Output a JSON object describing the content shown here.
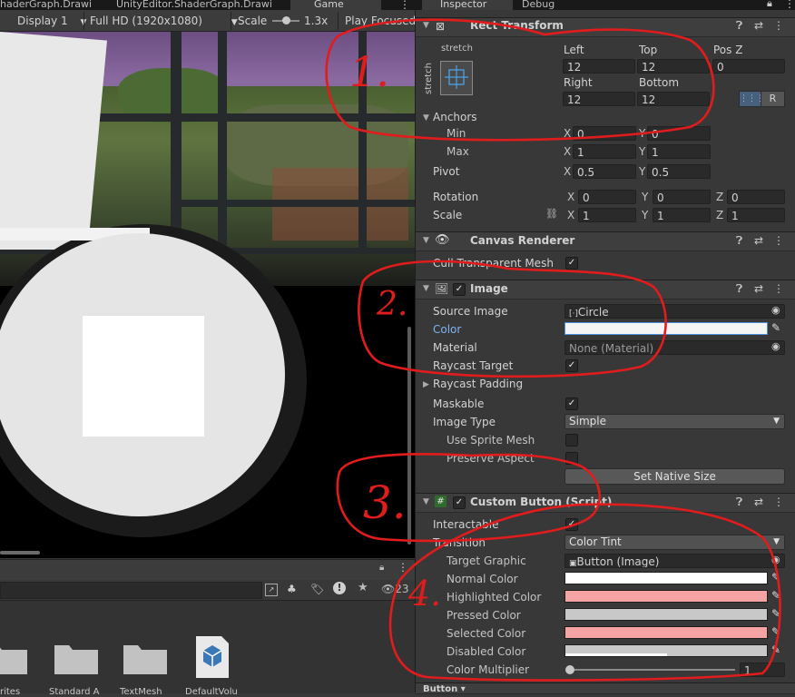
{
  "tabs": {
    "shadergraph1": "haderGraph.Drawi",
    "shadergraph2": "UnityEditor.ShaderGraph.Drawi",
    "game": "Game",
    "inspector": "Inspector",
    "debug": "Debug"
  },
  "game_toolbar": {
    "display": "Display 1",
    "resolution": "Full HD (1920x1080)",
    "scale_label": "Scale",
    "scale_value": "1.3x",
    "play_focused": "Play Focused"
  },
  "project": {
    "count": "23",
    "assets": [
      "rites",
      "Standard A",
      "TextMesh",
      "DefaultVolu"
    ]
  },
  "rect_transform": {
    "title": "Rect Transform",
    "anchor_preset_top": "stretch",
    "anchor_preset_side": "stretch",
    "left_label": "Left",
    "left": "12",
    "top_label": "Top",
    "top": "12",
    "posz_label": "Pos Z",
    "posz": "0",
    "right_label": "Right",
    "right": "12",
    "bottom_label": "Bottom",
    "bottom": "12",
    "raw_btn": "R",
    "anchors_label": "Anchors",
    "min_label": "Min",
    "min_x": "0",
    "min_y": "0",
    "max_label": "Max",
    "max_x": "1",
    "max_y": "1",
    "pivot_label": "Pivot",
    "pivot_x": "0.5",
    "pivot_y": "0.5",
    "rotation_label": "Rotation",
    "rot_x": "0",
    "rot_y": "0",
    "rot_z": "0",
    "scale_label": "Scale",
    "scale_x": "1",
    "scale_y": "1",
    "scale_z": "1"
  },
  "canvas_renderer": {
    "title": "Canvas Renderer",
    "cull_label": "Cull Transparent Mesh"
  },
  "image": {
    "title": "Image",
    "source_label": "Source Image",
    "source_value": "Circle",
    "color_label": "Color",
    "material_label": "Material",
    "material_value": "None (Material)",
    "raycast_target_label": "Raycast Target",
    "raycast_padding_label": "Raycast Padding",
    "maskable_label": "Maskable",
    "image_type_label": "Image Type",
    "image_type_value": "Simple",
    "use_sprite_mesh_label": "Use Sprite Mesh",
    "preserve_aspect_label": "Preserve Aspect",
    "set_native_size": "Set Native Size"
  },
  "custom_button": {
    "title": "Custom Button (Script)",
    "interactable_label": "Interactable",
    "transition_label": "Transition",
    "transition_value": "Color Tint",
    "target_graphic_label": "Target Graphic",
    "target_graphic_value": "Button (Image)",
    "normal_label": "Normal Color",
    "highlighted_label": "Highlighted Color",
    "pressed_label": "Pressed Color",
    "selected_label": "Selected Color",
    "disabled_label": "Disabled Color",
    "multiplier_label": "Color Multiplier",
    "multiplier_value": "1"
  },
  "bottom_partial": "Button",
  "colors": {
    "image_color": "#f5f5f5",
    "normal_color": "#ffffff",
    "highlighted_color": "#f5a3a3",
    "pressed_color": "#c8c8c8",
    "selected_color": "#f5a3a3",
    "disabled_color": "#c8c8c8"
  },
  "annotations": [
    "1.",
    "2.",
    "3.",
    "4."
  ]
}
